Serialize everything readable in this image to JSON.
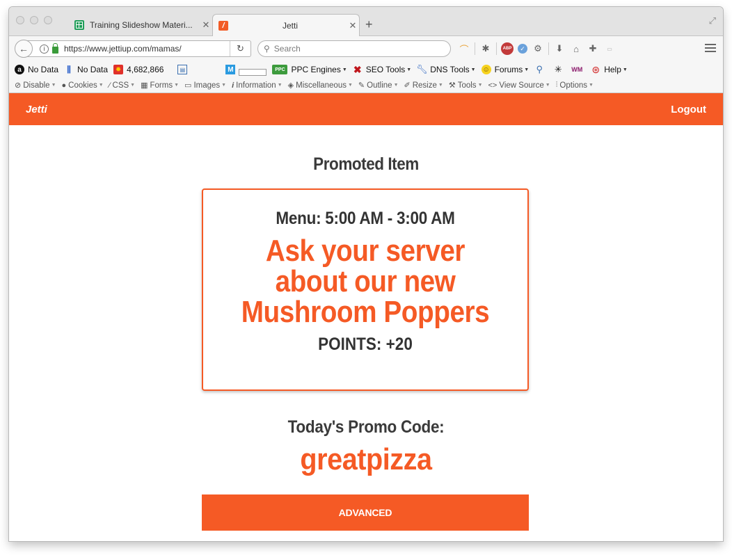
{
  "browser": {
    "tabs": [
      {
        "title": "Training Slideshow Materi...",
        "close": "✕",
        "icon": "google-sheets-icon"
      },
      {
        "title": "Jetti",
        "close": "✕",
        "icon": "jetti-favicon"
      }
    ],
    "new_tab": "+",
    "url": "https://www.jettiup.com/mamas/",
    "search_placeholder": "Search"
  },
  "bookmarks_bar": {
    "alexa": "No Data",
    "pagerank": "No Data",
    "rank": "4,682,866",
    "ppc": "PPC Engines",
    "seo": "SEO Tools",
    "dns": "DNS Tools",
    "forums": "Forums",
    "help": "Help"
  },
  "webdev_bar": {
    "items": [
      "Disable",
      "Cookies",
      "CSS",
      "Forms",
      "Images",
      "Information",
      "Miscellaneous",
      "Outline",
      "Resize",
      "Tools",
      "View Source",
      "Options"
    ]
  },
  "app": {
    "brand": "Jetti",
    "logout": "Logout",
    "accent_color": "#f55a25",
    "promoted_title": "Promoted Item",
    "menu_hours": "Menu: 5:00 AM - 3:00 AM",
    "promo_headline": "Ask your server about our new Mushroom Poppers",
    "points": "POINTS: +20",
    "promo_code_label": "Today's Promo Code:",
    "promo_code": "greatpizza",
    "advanced_button": "ADVANCED"
  }
}
